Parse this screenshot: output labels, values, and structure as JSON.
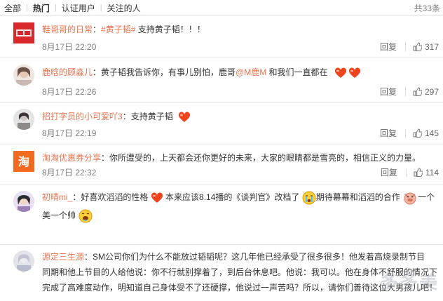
{
  "tabs": {
    "all": "全部",
    "hot": "热门",
    "verified": "认证用户",
    "following": "关注的人",
    "total": "共33条"
  },
  "comments": [
    {
      "user": "鞋哥哥的日常",
      "text_prefix": "：",
      "tag": "#黄子韬#",
      "text": " 支持黄子韬！！！",
      "time": "8月17日 22:20",
      "reply": "回复",
      "likes": "317"
    },
    {
      "user": "鹿晗的顾淼儿",
      "text_prefix": "：黄子韬我告诉你，有事儿别怕，鹿哥",
      "at": "@M鹿M",
      "text": " 和我们一直都在",
      "time": "8月17日 22:26",
      "reply": "回复",
      "likes": "297"
    },
    {
      "user": "招打字员的小可爱吖3",
      "text": "：支持黄子韬",
      "time": "8月17日 22:19",
      "reply": "回复",
      "likes": "145"
    },
    {
      "user": "淘淘优惠券分享",
      "text": "：你所遭受的，上天都会还你更好的未来，大家的眼睛都是雪亮的，相信正义的力量。",
      "time": "8月17日 22:32",
      "reply": "回复",
      "likes": "114"
    },
    {
      "user": "初晴mi_",
      "text_a": "：好喜欢滔滔的性格",
      "text_b": " 本来应该8.14播的《谈判官》改档了",
      "text_c": "期待幕幕和滔滔的合作",
      "text_d": "一个",
      "text_e": "美一个帅"
    },
    {
      "user": "源定三生源",
      "text_a": "：SM公司你们为什么不能放过韬韬呢？这几年他已经承受了很多很多！他发着高烧录制节目",
      "text_b": "同期和他上节目的人给他说：你不行就别撑着了，到后台休息吧。他说：我可以。他在身体不舒服的情况下",
      "text_c": "完成了高难度动作，明知道自己身体受不了还硬撑，他说过一声苦吗？所以，请你们善待这位大男孩儿吧！"
    }
  ],
  "watermark": "多多美"
}
